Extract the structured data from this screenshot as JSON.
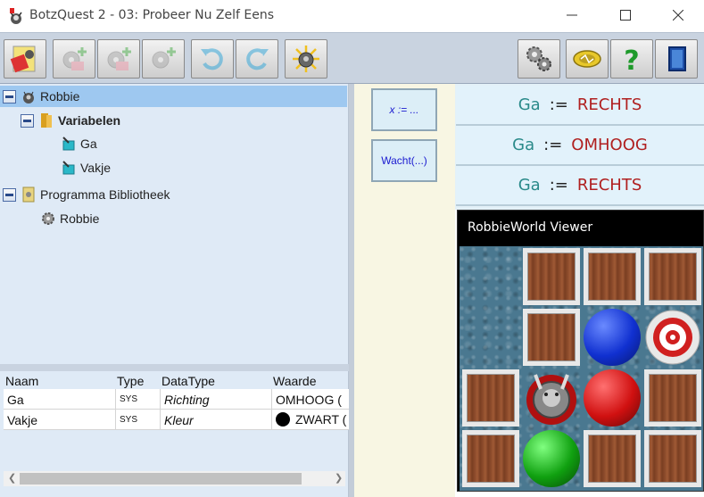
{
  "window": {
    "title": "BotzQuest 2 - 03: Probeer Nu Zelf Eens"
  },
  "toolbar": {
    "left_buttons": [
      "robot-card-icon",
      "add-gear-icon",
      "add-gear-icon",
      "add-gear-icon",
      "undo-icon",
      "redo-icon",
      "sun-bot-icon"
    ],
    "right_buttons": [
      "gears-icon",
      "coin-icon",
      "help-icon",
      "exit-door-icon"
    ]
  },
  "tree": {
    "root": "Robbie",
    "variables_group": "Variabelen",
    "variables": [
      "Ga",
      "Vakje"
    ],
    "library_group": "Programma Bibliotheek",
    "library_items": [
      "Robbie"
    ]
  },
  "table": {
    "headers": [
      "Naam",
      "Type",
      "DataType",
      "Waarde"
    ],
    "rows": [
      {
        "name": "Ga",
        "type": "SYS",
        "datatype": "Richting",
        "value": "OMHOOG ("
      },
      {
        "name": "Vakje",
        "type": "SYS",
        "datatype": "Kleur",
        "value": "ZWART ("
      }
    ]
  },
  "palette": {
    "assign_label": "x := ...",
    "wait_label": "Wacht(...)"
  },
  "program": {
    "statements": [
      {
        "var": "Ga",
        "op": ":=",
        "value": "RECHTS"
      },
      {
        "var": "Ga",
        "op": ":=",
        "value": "OMHOOG"
      },
      {
        "var": "Ga",
        "op": ":=",
        "value": "RECHTS"
      }
    ]
  },
  "viewer": {
    "title": "RobbieWorld Viewer"
  },
  "colors": {
    "toolbar": "#c9d3e0",
    "tree_bg": "#dfeaf6",
    "selection": "#9ec8f0",
    "keyword_var": "#2a8a8a",
    "keyword_value": "#b02020"
  }
}
